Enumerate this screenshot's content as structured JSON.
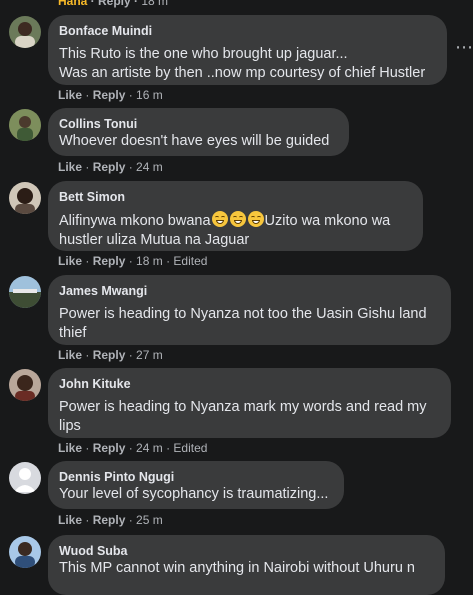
{
  "top_actions": {
    "first": "Haha",
    "reply": "Reply",
    "time": "18 m"
  },
  "labels": {
    "like": "Like",
    "reply": "Reply",
    "sep": " · "
  },
  "comments": [
    {
      "name": "Bonface Muindi",
      "text": "This Ruto is the one who brought up jaguar...\nWas an artiste by then ..now mp courtesy of chief Hustler",
      "time": "16 m",
      "edited": ""
    },
    {
      "name": "Collins Tonui",
      "text": "Whoever doesn't have eyes will be guided",
      "time": "24 m",
      "edited": ""
    },
    {
      "name": "Bett Simon",
      "text_before": "Alifinywa mkono bwana",
      "text_after": "Uzito wa mkono wa\nhustler uliza Mutua na Jaguar",
      "emoji": "grinning-face-emoji",
      "time": "18 m",
      "edited": "Edited"
    },
    {
      "name": "James Mwangi",
      "text": "Power is heading to Nyanza not too the Uasin Gishu land\nthief",
      "time": "27 m",
      "edited": ""
    },
    {
      "name": "John Kituke",
      "text": "Power is heading to Nyanza mark my words and read my\nlips",
      "time": "24 m",
      "edited": "Edited"
    },
    {
      "name": "Dennis Pinto Ngugi",
      "text": "Your level of sycophancy is traumatizing...",
      "time": "25 m",
      "edited": ""
    },
    {
      "name": "Wuod Suba",
      "text": "This MP cannot win anything in Nairobi without Uhuru n",
      "time": "",
      "edited": ""
    }
  ],
  "icons": {
    "more": "more-options-icon"
  },
  "colors": {
    "background": "#18191a",
    "bubble": "#3a3b3c",
    "text": "#e4e6eb",
    "muted": "#b0b3b8",
    "haha": "#f7b928"
  }
}
